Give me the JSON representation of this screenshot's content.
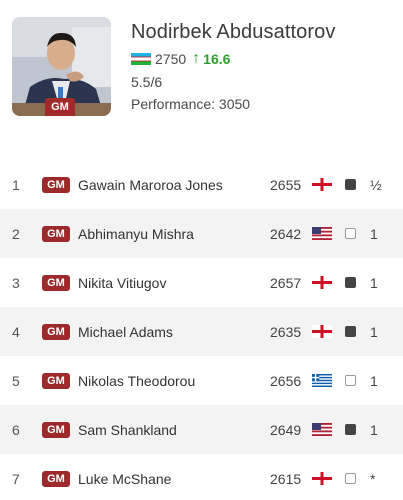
{
  "player": {
    "name": "Nodirbek Abdusattorov",
    "title": "GM",
    "rating": "2750",
    "rating_change": "16.6",
    "score": "5.5/6",
    "performance": "Performance: 3050"
  },
  "games": [
    {
      "round": "1",
      "title": "GM",
      "opponent": "Gawain Maroroa Jones",
      "rating": "2655",
      "flag": "england-flag-icon",
      "color": "black",
      "result": "½"
    },
    {
      "round": "2",
      "title": "GM",
      "opponent": "Abhimanyu Mishra",
      "rating": "2642",
      "flag": "usa-flag-icon",
      "color": "white",
      "result": "1"
    },
    {
      "round": "3",
      "title": "GM",
      "opponent": "Nikita Vitiugov",
      "rating": "2657",
      "flag": "england-flag-icon",
      "color": "black",
      "result": "1"
    },
    {
      "round": "4",
      "title": "GM",
      "opponent": "Michael Adams",
      "rating": "2635",
      "flag": "england-flag-icon",
      "color": "black",
      "result": "1"
    },
    {
      "round": "5",
      "title": "GM",
      "opponent": "Nikolas Theodorou",
      "rating": "2656",
      "flag": "greece-flag-icon",
      "color": "white",
      "result": "1"
    },
    {
      "round": "6",
      "title": "GM",
      "opponent": "Sam Shankland",
      "rating": "2649",
      "flag": "usa-flag-icon",
      "color": "black",
      "result": "1"
    },
    {
      "round": "7",
      "title": "GM",
      "opponent": "Luke McShane",
      "rating": "2615",
      "flag": "england-flag-icon",
      "color": "white",
      "result": "*"
    }
  ],
  "colors": {
    "gm_badge": "#9c2a2a",
    "gain_green": "#2f9e2f",
    "alt_row": "#f3f3f3"
  }
}
